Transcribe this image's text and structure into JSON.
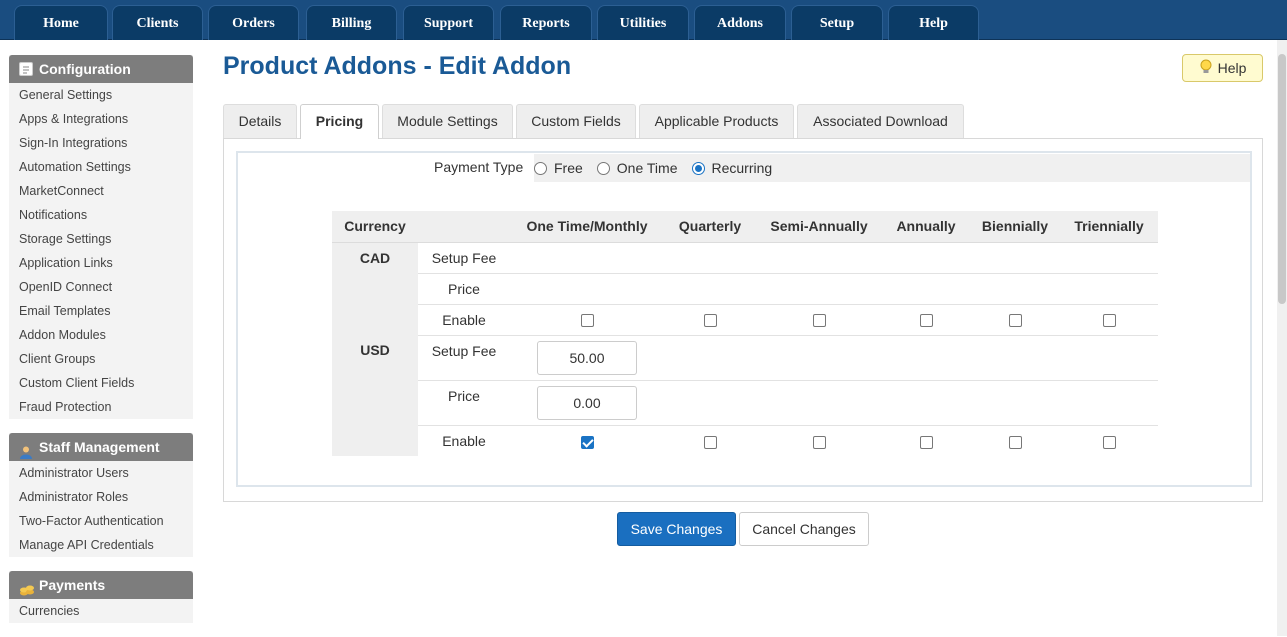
{
  "nav": {
    "tabs": [
      "Home",
      "Clients",
      "Orders",
      "Billing",
      "Support",
      "Reports",
      "Utilities",
      "Addons",
      "Setup",
      "Help"
    ]
  },
  "sidebar": {
    "sections": [
      {
        "title": "Configuration",
        "icon": "document-icon",
        "items": [
          "General Settings",
          "Apps & Integrations",
          "Sign-In Integrations",
          "Automation Settings",
          "MarketConnect",
          "Notifications",
          "Storage Settings",
          "Application Links",
          "OpenID Connect",
          "Email Templates",
          "Addon Modules",
          "Client Groups",
          "Custom Client Fields",
          "Fraud Protection"
        ]
      },
      {
        "title": "Staff Management",
        "icon": "user-icon",
        "items": [
          "Administrator Users",
          "Administrator Roles",
          "Two-Factor Authentication",
          "Manage API Credentials"
        ]
      },
      {
        "title": "Payments",
        "icon": "coins-icon",
        "items": [
          "Currencies"
        ]
      }
    ]
  },
  "page": {
    "title": "Product Addons - Edit Addon",
    "help_label": "Help"
  },
  "tabs": [
    "Details",
    "Pricing",
    "Module Settings",
    "Custom Fields",
    "Applicable Products",
    "Associated Download"
  ],
  "active_tab": "Pricing",
  "pricing": {
    "payment_type_label": "Payment Type",
    "payment_options": [
      "Free",
      "One Time",
      "Recurring"
    ],
    "selected_payment": "Recurring",
    "columns": [
      "Currency",
      "",
      "One Time/Monthly",
      "Quarterly",
      "Semi-Annually",
      "Annually",
      "Biennially",
      "Triennially"
    ],
    "row_labels": {
      "setup_fee": "Setup Fee",
      "price": "Price",
      "enable": "Enable"
    },
    "currencies": [
      {
        "code": "CAD",
        "setup_fee": [],
        "price": [],
        "enabled": [
          false,
          false,
          false,
          false,
          false,
          false
        ]
      },
      {
        "code": "USD",
        "setup_fee": [
          "50.00"
        ],
        "price": [
          "0.00"
        ],
        "enabled": [
          true,
          false,
          false,
          false,
          false,
          false
        ]
      }
    ]
  },
  "actions": {
    "save_label": "Save Changes",
    "cancel_label": "Cancel Changes"
  },
  "colors": {
    "nav_bg": "#1a4d80",
    "nav_tab": "#0b3b66",
    "title": "#1a5a96",
    "primary_button": "#1a6fc0"
  }
}
